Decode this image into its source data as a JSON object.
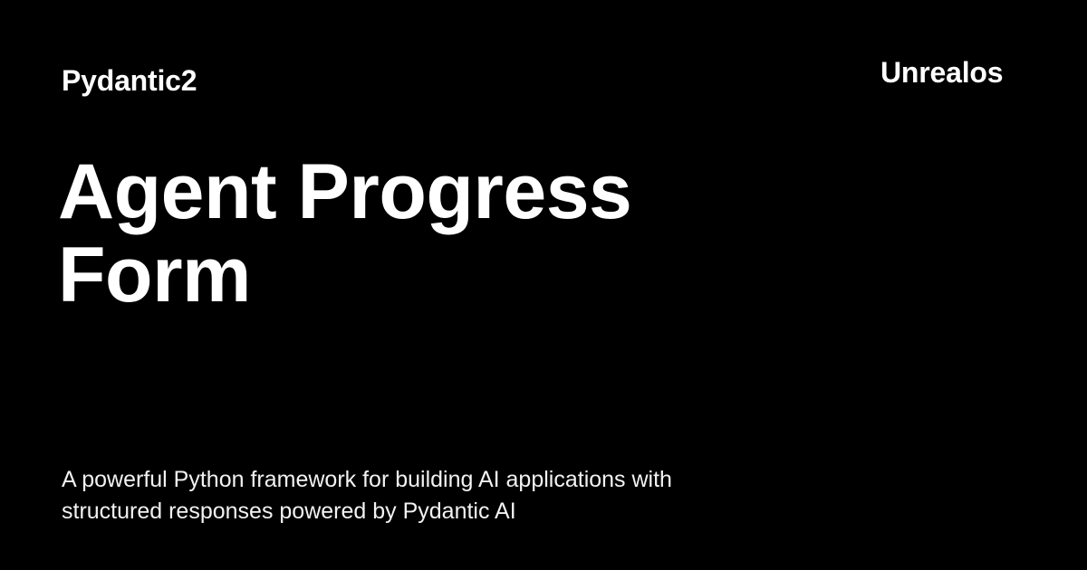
{
  "card": {
    "section_name": "Pydantic2",
    "site_name": "Unrealos",
    "title_lines": [
      "Agent Progress",
      "Form"
    ],
    "description_lines": [
      "A powerful Python framework for building AI applications with",
      "structured responses powered by Pydantic AI"
    ]
  },
  "colors": {
    "background": "#000000",
    "text": "#ffffff"
  }
}
